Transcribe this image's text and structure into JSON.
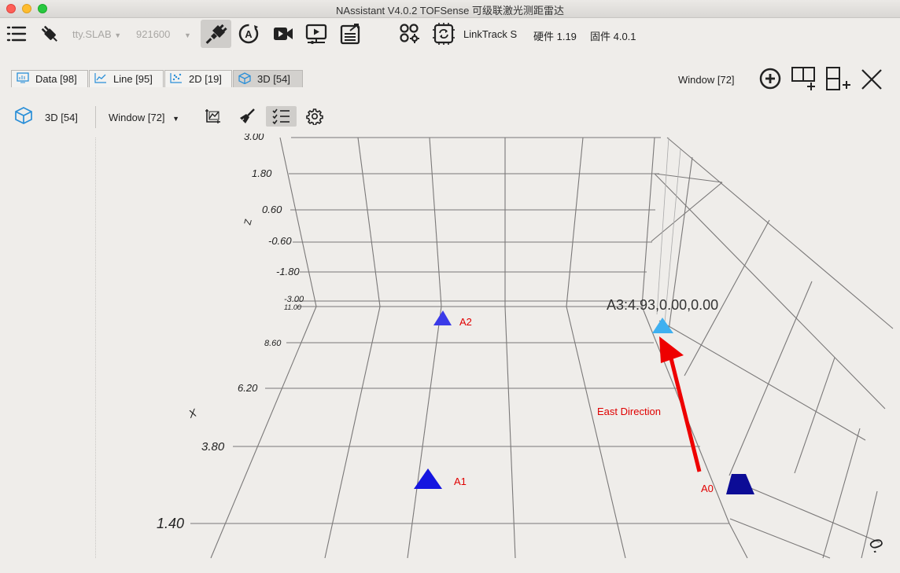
{
  "window": {
    "title": "NAssistant V4.0.2   TOFSense 可级联激光测距雷达"
  },
  "toolbar": {
    "port": "tty.SLAB",
    "baud": "921600",
    "device_name": "LinkTrack S",
    "hardware": "硬件 1.19",
    "firmware": "固件 4.0.1"
  },
  "tabs": [
    {
      "label": "Data [98]"
    },
    {
      "label": "Line [95]"
    },
    {
      "label": "2D [19]"
    },
    {
      "label": "3D [54]"
    }
  ],
  "window_selector": {
    "label": "Window  [72]"
  },
  "subbar": {
    "view_label": "3D [54]",
    "window_label": "Window  [72]"
  },
  "plot": {
    "z_axis_label": "Z",
    "x_axis_label": "X",
    "z_ticks": [
      "3.00",
      "1.80",
      "0.60",
      "-0.60",
      "-1.80",
      "-3.00"
    ],
    "x_ticks": [
      "11.00",
      "8.60",
      "6.20",
      "3.80",
      "1.40"
    ],
    "corner_tick": "0.",
    "tooltip": "A3:4.93,0.00,0.00",
    "annotation": "East Direction",
    "anchors": [
      {
        "name": "A0",
        "color": "#10109a"
      },
      {
        "name": "A1",
        "color": "#1a1ae0"
      },
      {
        "name": "A2",
        "color": "#3333ee"
      },
      {
        "name": "A3",
        "color": "#3fb0f0"
      }
    ],
    "label_color": "#e00000",
    "arrow_color": "#ee0000"
  }
}
